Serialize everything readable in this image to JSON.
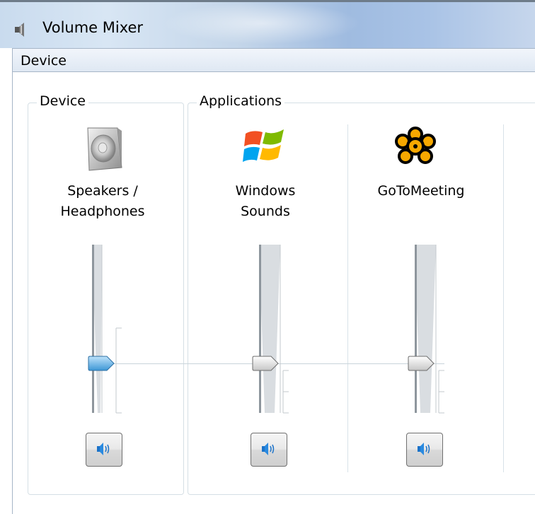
{
  "window": {
    "title": "Volume Mixer",
    "icon": "speaker-icon"
  },
  "menu": {
    "items": [
      "Device"
    ]
  },
  "device_group": {
    "title": "Device",
    "channel": {
      "name_line1": "Speakers /",
      "name_line2": "Headphones",
      "icon": "speaker-device-icon",
      "mute_icon": "speaker-volume-icon"
    }
  },
  "applications_group": {
    "title": "Applications",
    "channels": [
      {
        "name_line1": "Windows",
        "name_line2": "Sounds",
        "icon": "windows-logo-icon",
        "mute_icon": "speaker-volume-icon"
      },
      {
        "name_line1": "GoToMeeting",
        "name_line2": "",
        "icon": "gotomeeting-flower-icon",
        "mute_icon": "speaker-volume-icon"
      }
    ]
  },
  "colors": {
    "accent_thumb": "#4aa3df",
    "title_bar": "#c6d6ec",
    "menu_bar": "#e5edf6"
  }
}
